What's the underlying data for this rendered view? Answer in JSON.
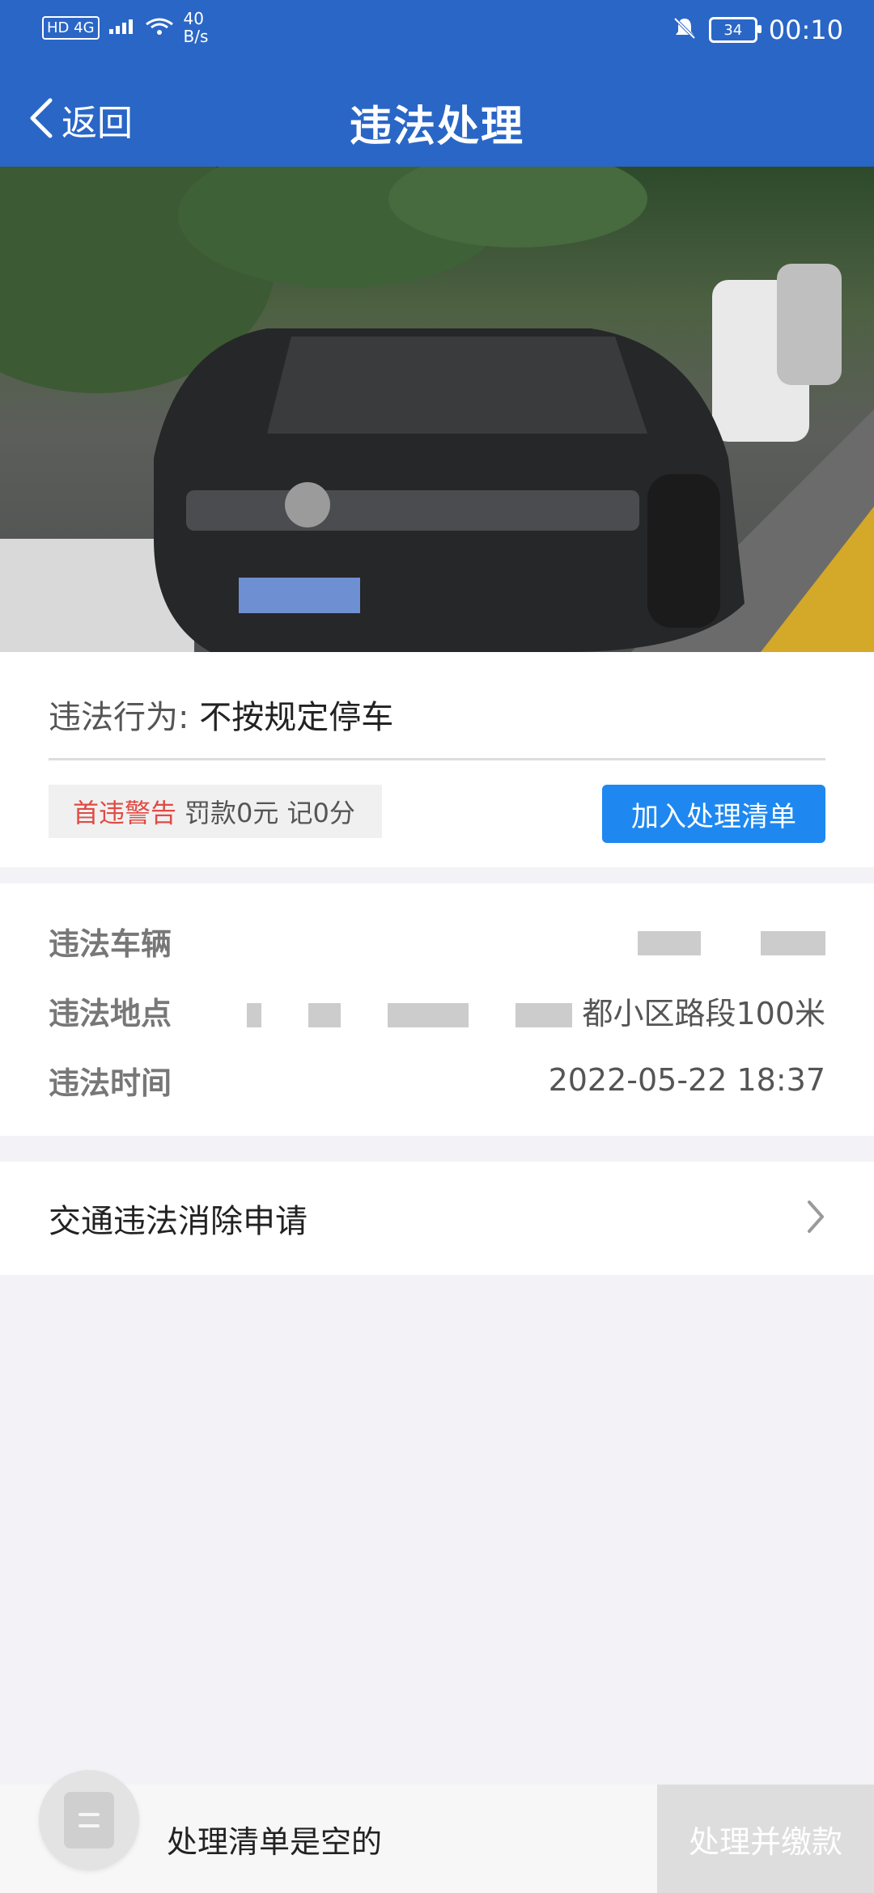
{
  "status_bar": {
    "network": "HD 4G",
    "speed_value": "40",
    "speed_unit": "B/s",
    "battery": "34",
    "time": "00:10"
  },
  "nav": {
    "back_label": "返回",
    "title": "违法处理"
  },
  "violation": {
    "behavior_label": "违法行为:",
    "behavior_value": "不按规定停车",
    "penalty": {
      "first_warning": "首违警告",
      "detail": "罚款0元 记0分"
    },
    "add_button": "加入处理清单"
  },
  "details": {
    "vehicle_label": "违法车辆",
    "location_label": "违法地点",
    "location_value_suffix": "都小区路段100米",
    "time_label": "违法时间",
    "time_value": "2022-05-22 18:37"
  },
  "elimination": {
    "label": "交通违法消除申请"
  },
  "bottom_bar": {
    "empty_text": "处理清单是空的",
    "pay_button": "处理并缴款"
  }
}
